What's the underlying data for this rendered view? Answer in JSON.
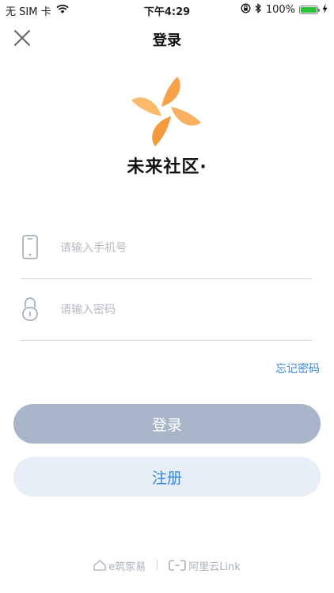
{
  "status_bar": {
    "carrier": "无 SIM 卡",
    "time": "下午4:29",
    "battery": "100%",
    "battery_level": 1.0,
    "icons": [
      "wifi-icon",
      "lock-rotation-icon",
      "bluetooth-icon",
      "battery-icon",
      "charging-icon"
    ]
  },
  "nav": {
    "title": "登录",
    "close_icon": "close-icon"
  },
  "app": {
    "name": "未来社区·",
    "logo_icon": "pinwheel-logo",
    "logo_color": "#f7a24a"
  },
  "form": {
    "phone": {
      "placeholder": "请输入手机号",
      "value": "",
      "icon": "phone-icon"
    },
    "password": {
      "placeholder": "请输入密码",
      "value": "",
      "icon": "lock-icon"
    },
    "forgot_label": "忘记密码"
  },
  "buttons": {
    "login_label": "登录",
    "register_label": "注册"
  },
  "footer": {
    "brand1": "e筑家易",
    "brand2": "阿里云Link"
  },
  "colors": {
    "accent": "#3a86d6",
    "login_button_bg": "#a8b5c8",
    "register_button_bg": "#e7eef7"
  }
}
